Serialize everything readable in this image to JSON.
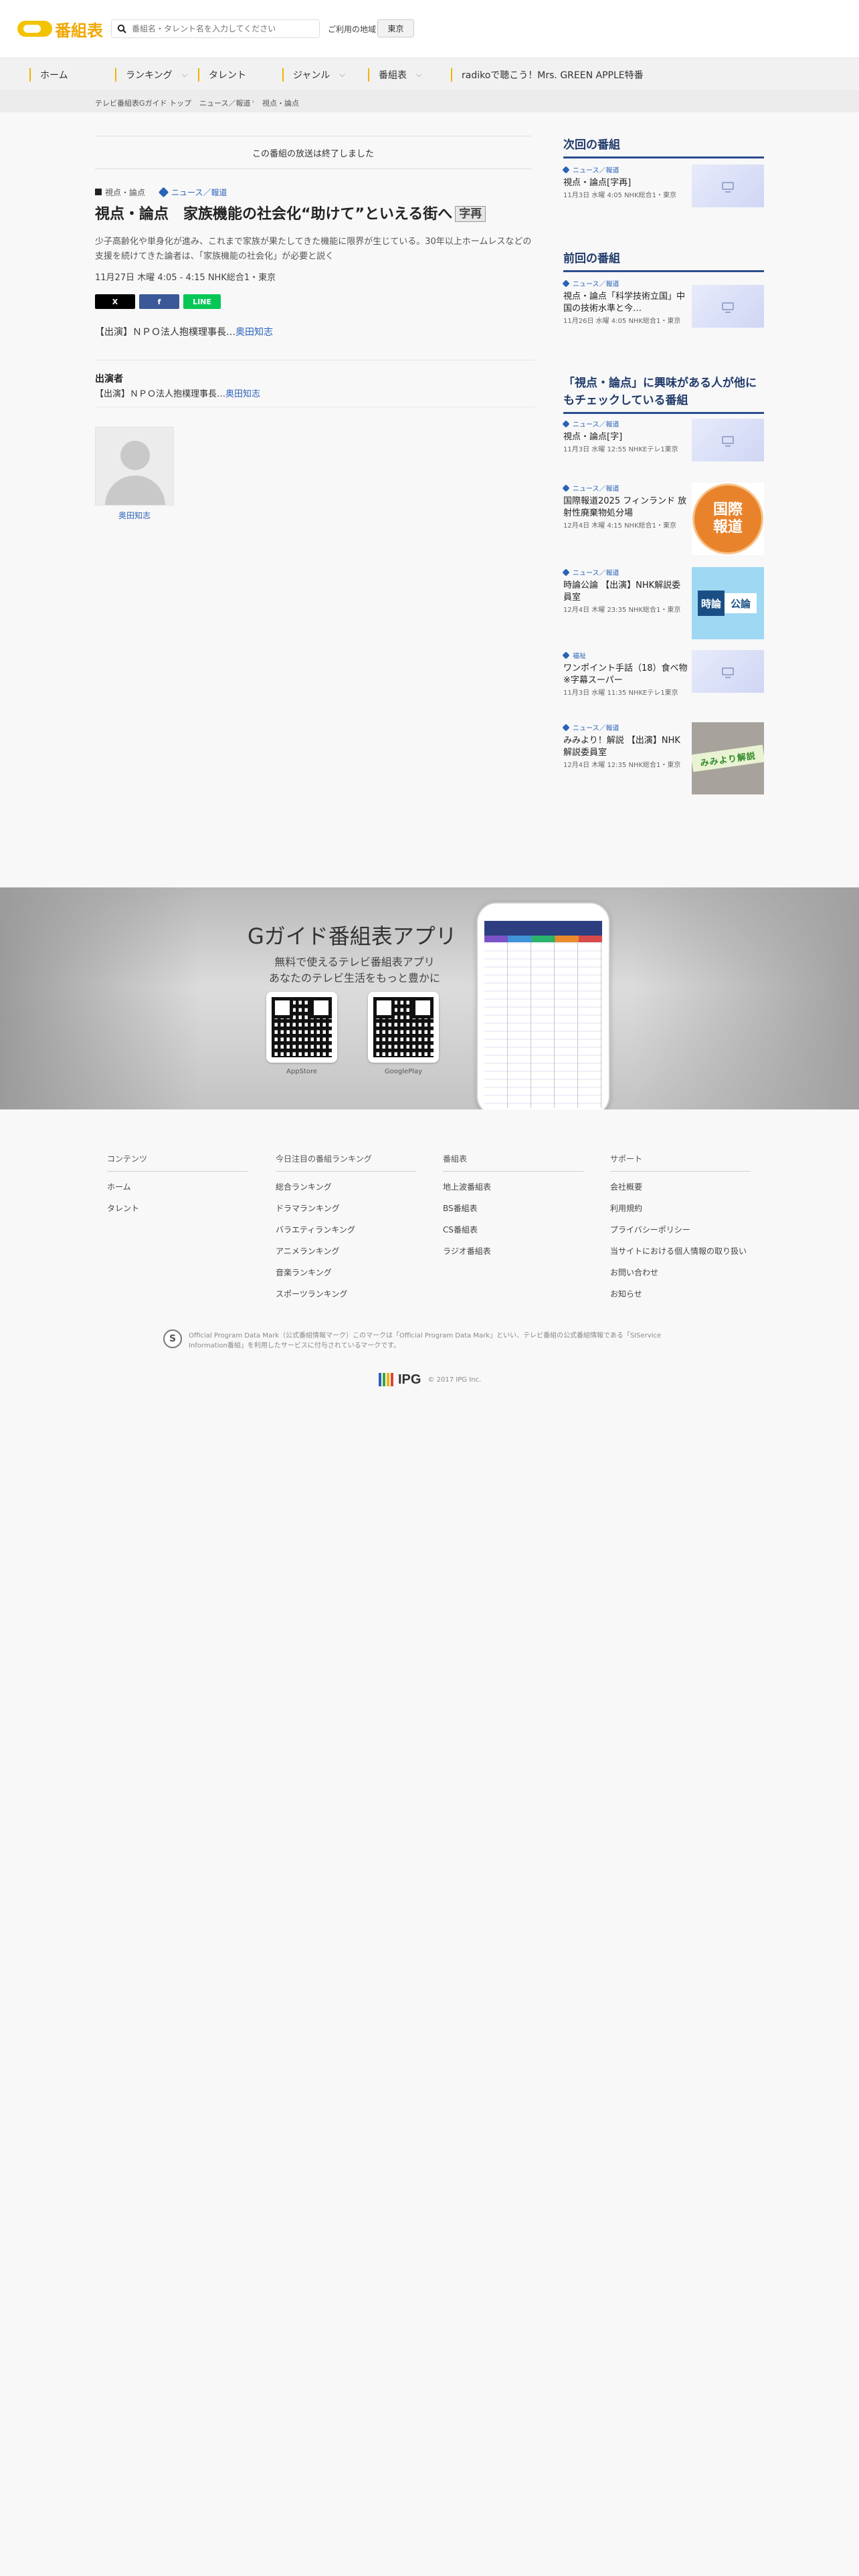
{
  "header": {
    "logo_text": "番組表",
    "search_placeholder": "番組名・タレント名を入力してください",
    "region_label": "ご利用の地域",
    "region_value": "東京"
  },
  "nav": [
    {
      "label": "ホーム",
      "has_menu": false
    },
    {
      "label": "ランキング",
      "has_menu": true
    },
    {
      "label": "タレント",
      "has_menu": false
    },
    {
      "label": "ジャンル",
      "has_menu": true
    },
    {
      "label": "番組表",
      "has_menu": true
    },
    {
      "label": "radikoで聴こう！Mrs. GREEN APPLE特番",
      "has_menu": false
    }
  ],
  "breadcrumb": [
    "テレビ番組表Gガイド トップ",
    "ニュース／報道",
    "視点・論点"
  ],
  "program": {
    "notice": "この番組の放送は終了しました",
    "series": "視点・論点",
    "genre": "ニュース／報道",
    "title": "視点・論点　家族機能の社会化“助けて”といえる街へ",
    "title_chip": "字再",
    "description": "少子高齢化や単身化が進み、これまで家族が果たしてきた機能に限界が生じている。30年以上ホームレスなどの支援を続けてきた論者は、「家族機能の社会化」が必要と説く",
    "datetime": "11月27日 木曜 4:05 - 4:15 NHK総合1・東京",
    "share": {
      "x": "X",
      "facebook": "f",
      "line": "LINE"
    },
    "cast_prefix": "【出演】ＮＰＯ法人抱樸理事長…",
    "cast_name": "奥田知志",
    "cast_section_title": "出演者",
    "cast_section_prefix": "【出演】ＮＰＯ法人抱樸理事長…",
    "cast_section_name": "奥田知志",
    "talent_name": "奥田知志"
  },
  "sidebar": {
    "next_title": "次回の番組",
    "next": {
      "genre": "ニュース／報道",
      "title": "視点・論点[字再]",
      "meta": "11月3日 水曜 4:05 NHK総合1・東京"
    },
    "prev_title": "前回の番組",
    "prev": {
      "genre": "ニュース／報道",
      "title": "視点・論点「科学技術立国」中国の技術水準と今…",
      "meta": "11月26日 水曜 4:05 NHK総合1・東京"
    },
    "related_title": "「視点・論点」に興味がある人が他にもチェックしている番組",
    "related": [
      {
        "genre": "ニュース／報道",
        "title": "視点・論点[字]",
        "meta": "11月3日 水曜 12:55 NHKEテレ1東京",
        "thumb": "tv-icon"
      },
      {
        "genre": "ニュース／報道",
        "title": "国際報道2025 フィンランド 放射性廃棄物処分場",
        "meta": "12月4日 木曜 4:15 NHK総合1・東京",
        "thumb": "kokusai",
        "thumb_text": [
          "国際",
          "報道"
        ]
      },
      {
        "genre": "ニュース／報道",
        "title": "時論公論 【出演】NHK解説委員室",
        "meta": "12月4日 木曜 23:35 NHK総合1・東京",
        "thumb": "jiron",
        "thumb_text": [
          "時論",
          "公論"
        ]
      },
      {
        "genre": "福祉",
        "title": "ワンポイント手話（18）食べ物 ※字幕スーパー",
        "meta": "11月3日 水曜 11:35 NHKEテレ1東京",
        "thumb": "tv-icon"
      },
      {
        "genre": "ニュース／報道",
        "title": "みみより！解説 【出演】NHK解説委員室",
        "meta": "12月4日 木曜 12:35 NHK総合1・東京",
        "thumb": "miyori",
        "thumb_text": "みみより解説"
      }
    ]
  },
  "app_banner": {
    "title": "Gガイド番組表アプリ",
    "subtitle_line1": "無料で使えるテレビ番組表アプリ",
    "subtitle_line2": "あなたのテレビ生活をもっと豊かに",
    "qr_labels": [
      "AppStore",
      "GooglePlay"
    ]
  },
  "footer": {
    "columns": [
      {
        "heading": "コンテンツ",
        "links": [
          "ホーム",
          "タレント"
        ]
      },
      {
        "heading": "今日注目の番組ランキング",
        "links": [
          "総合ランキング",
          "ドラマランキング",
          "バラエティランキング",
          "アニメランキング",
          "音楽ランキング",
          "スポーツランキング"
        ]
      },
      {
        "heading": "番組表",
        "links": [
          "地上波番組表",
          "BS番組表",
          "CS番組表",
          "ラジオ番組表"
        ]
      },
      {
        "heading": "サポート",
        "links": [
          "会社概要",
          "利用規約",
          "プライバシーポリシー",
          "当サイトにおける個人情報の取り扱い",
          "お問い合わせ",
          "お知らせ"
        ]
      }
    ],
    "copyright_mark": "S",
    "copyright_text": "Official Program Data Mark（公式番組情報マーク）このマークは「Official Program Data Mark」といい、テレビ番組の公式番組情報である「SIService Information番組」を利用したサービスに付与されているマークです。",
    "brand": "IPG",
    "brand_copy": "© 2017 IPG Inc.",
    "brand_colors": [
      "#2a62b8",
      "#3fa34d",
      "#f0b400",
      "#e0442f"
    ]
  },
  "colors": {
    "accent": "#f0b400",
    "link": "#2a62b8",
    "side_heading": "#203a6a"
  }
}
